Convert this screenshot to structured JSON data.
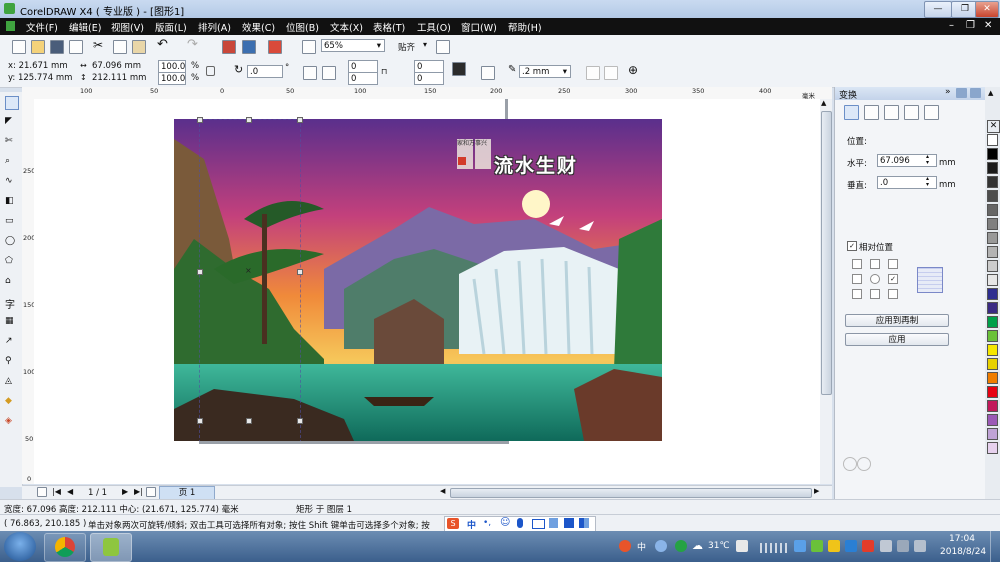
{
  "window": {
    "title": "CorelDRAW X4 ( 专业版 ) - [图形1]",
    "minimize": "—",
    "restore": "❐",
    "close": "✕"
  },
  "menu": [
    "文件(F)",
    "编辑(E)",
    "视图(V)",
    "版面(L)",
    "排列(A)",
    "效果(C)",
    "位图(B)",
    "文本(X)",
    "表格(T)",
    "工具(O)",
    "窗口(W)",
    "帮助(H)"
  ],
  "toolbar": {
    "zoom": "65%",
    "snap": "贴齐"
  },
  "property_bar": {
    "x": "x: 21.671 mm",
    "y": "y: 125.774 mm",
    "width": "67.096 mm",
    "height": "212.111 mm",
    "scale_x": "100.0",
    "scale_y": "100.0",
    "pct": "%",
    "rotation": ".0",
    "deg": "°",
    "corner_1": "0",
    "corner_2": "0",
    "corner_3": "0",
    "corner_4": "0",
    "outline": ".2 mm"
  },
  "ruler_h": [
    "100",
    "50",
    "0",
    "50",
    "100",
    "150",
    "200",
    "250",
    "300",
    "350",
    "400",
    "毫米"
  ],
  "ruler_v": [
    "250",
    "200",
    "150",
    "100",
    "50",
    "0"
  ],
  "picture": {
    "headline": "流水生财",
    "seal_text": "家和万事兴"
  },
  "page_nav": {
    "count": "1 / 1",
    "tab": "页 1"
  },
  "docker": {
    "title": "变换",
    "position_label": "位置:",
    "horizontal_label": "水平:",
    "horizontal_value": "67.096",
    "horizontal_unit": "mm",
    "vertical_label": "垂直:",
    "vertical_value": ".0",
    "vertical_unit": "mm",
    "relative_label": "相对位置",
    "apply_copy": "应用到再制",
    "apply": "应用"
  },
  "palette": [
    "#ffffff",
    "#000000",
    "#1a1a1a",
    "#333333",
    "#4d4d4d",
    "#666666",
    "#808080",
    "#999999",
    "#b3b3b3",
    "#cccccc",
    "#e6e6e6",
    "#2d2d8f",
    "#3a2a84",
    "#00a04a",
    "#6ac13a",
    "#f5e600",
    "#e8d100",
    "#ef7d00",
    "#e60012",
    "#c2185b",
    "#9b59b6",
    "#bfa3d6",
    "#e6d1ee"
  ],
  "status": {
    "size": "宽度: 67.096 高度: 212.111 中心: (21.671, 125.774) 毫米",
    "object": "矩形 于 图层 1",
    "coords": "( 76.863, 210.185 )",
    "hint": "单击对象两次可旋转/倾斜; 双击工具可选择所有对象; 按住 Shift 键单击可选择多个对象; 按"
  },
  "ime": {
    "label": "中"
  },
  "tray": {
    "temperature": "31℃",
    "time": "17:04",
    "date": "2018/8/24"
  }
}
